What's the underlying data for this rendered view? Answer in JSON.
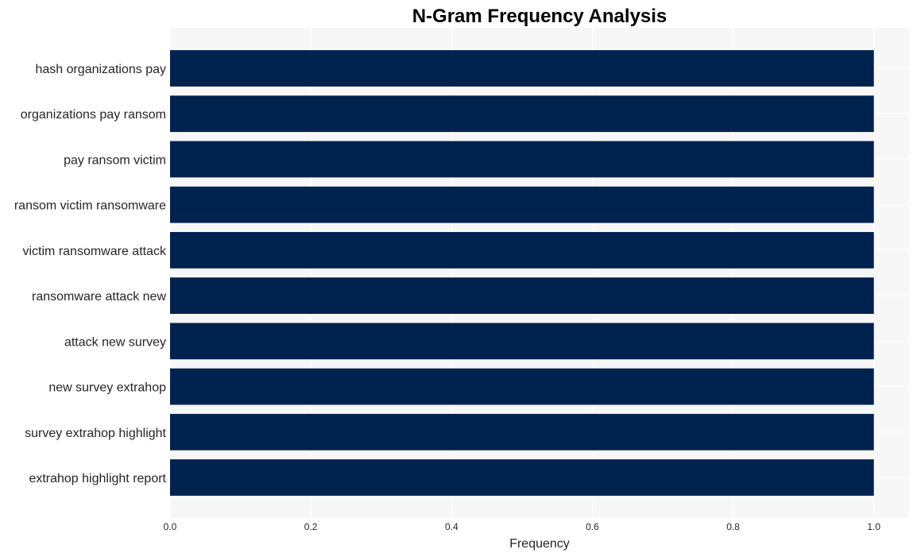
{
  "chart_data": {
    "type": "bar",
    "orientation": "horizontal",
    "title": "N-Gram Frequency Analysis",
    "xlabel": "Frequency",
    "ylabel": "",
    "categories": [
      "hash organizations pay",
      "organizations pay ransom",
      "pay ransom victim",
      "ransom victim ransomware",
      "victim ransomware attack",
      "ransomware attack new",
      "attack new survey",
      "new survey extrahop",
      "survey extrahop highlight",
      "extrahop highlight report"
    ],
    "values": [
      1,
      1,
      1,
      1,
      1,
      1,
      1,
      1,
      1,
      1
    ],
    "xlim": [
      0,
      1.05
    ],
    "xticks": [
      "0.0",
      "0.2",
      "0.4",
      "0.6",
      "0.8",
      "1.0"
    ],
    "xtick_values": [
      0,
      0.2,
      0.4,
      0.6,
      0.8,
      1.0
    ],
    "grid": true,
    "legend": "none",
    "colors": {
      "bar": "#00224e",
      "plot_background": "#f7f7f7",
      "grid": "#ffffff"
    }
  }
}
